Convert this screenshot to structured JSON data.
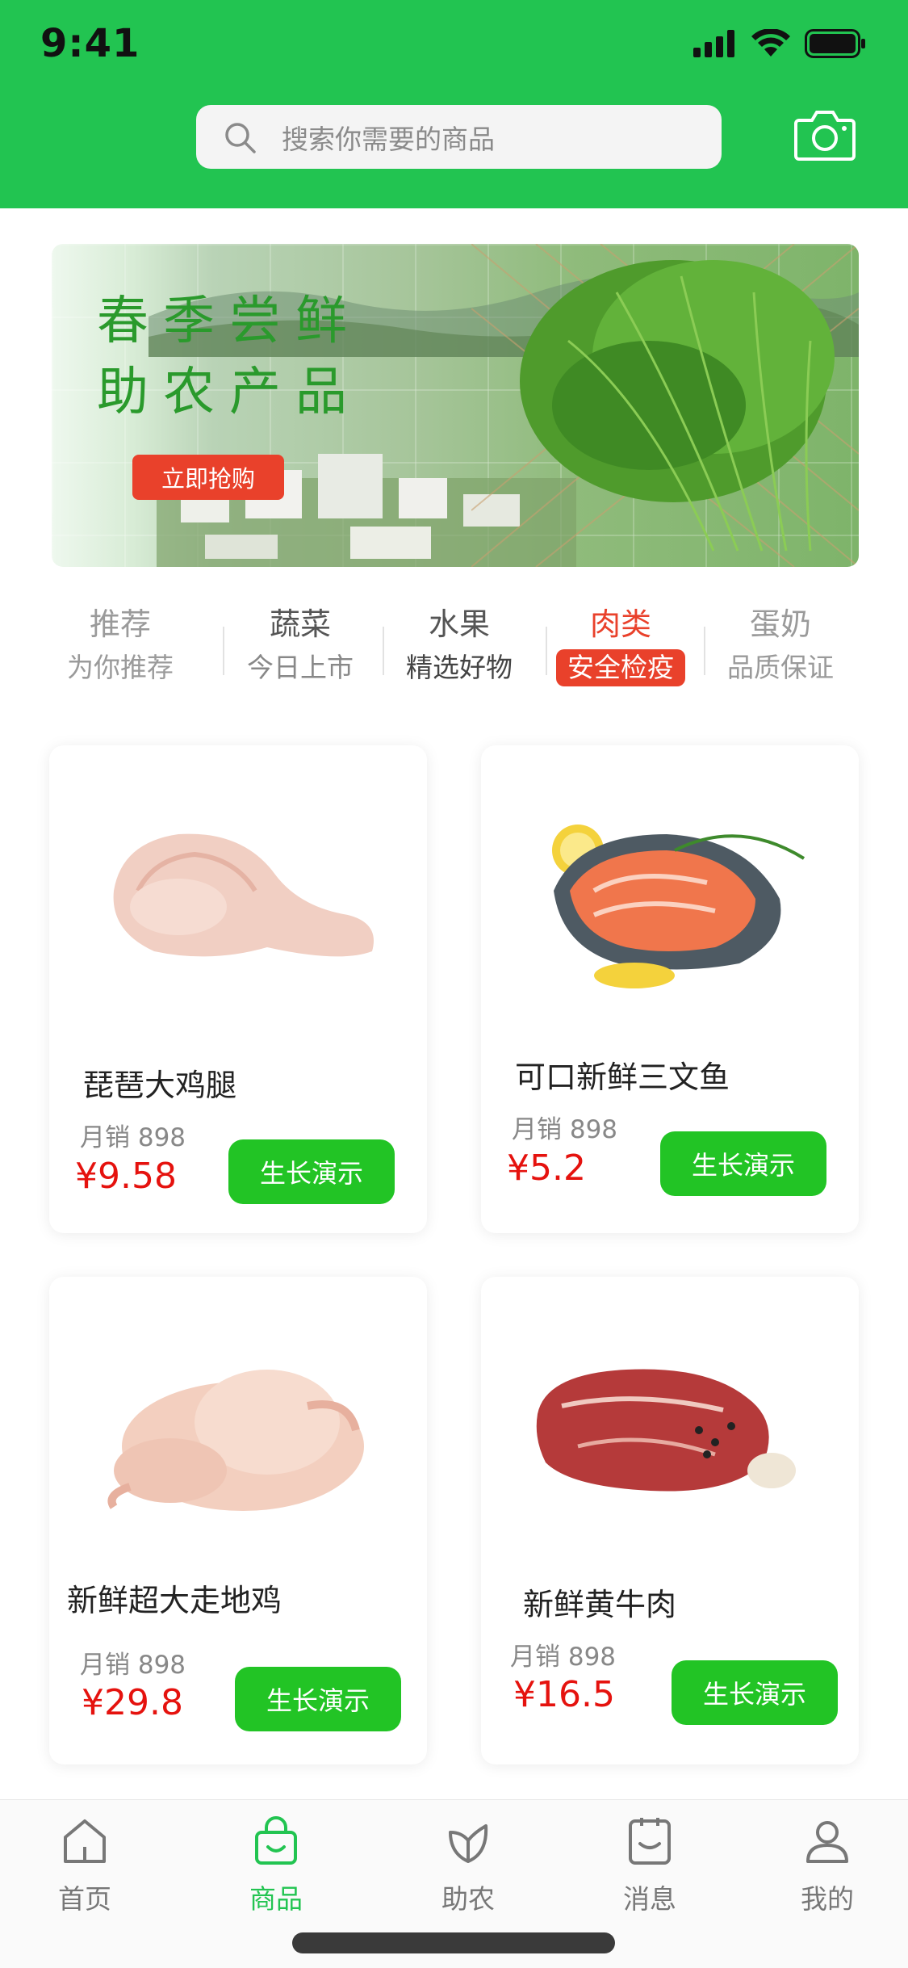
{
  "status_bar": {
    "time": "9:41"
  },
  "search": {
    "placeholder": "搜索你需要的商品"
  },
  "banner": {
    "line1": "春季尝鲜",
    "line2": "助农产品",
    "button": "立即抢购"
  },
  "categories": [
    {
      "title": "推荐",
      "subtitle": "为你推荐"
    },
    {
      "title": "蔬菜",
      "subtitle": "今日上市"
    },
    {
      "title": "水果",
      "subtitle": "精选好物"
    },
    {
      "title": "肉类",
      "subtitle": "安全检疫"
    },
    {
      "title": "蛋奶",
      "subtitle": "品质保证"
    }
  ],
  "products": [
    {
      "name": "琵琶大鸡腿",
      "sales": "月销 898",
      "price": "¥9.58",
      "button": "生长演示"
    },
    {
      "name": "可口新鲜三文鱼",
      "sales": "月销 898",
      "price": "¥5.2",
      "button": "生长演示"
    },
    {
      "name": "新鲜超大走地鸡",
      "sales": "月销  898",
      "price": "¥29.8",
      "button": "生长演示"
    },
    {
      "name": "新鲜黄牛肉",
      "sales": "月销  898",
      "price": "¥16.5",
      "button": "生长演示"
    }
  ],
  "tabs": [
    {
      "label": "首页",
      "icon": "home-icon"
    },
    {
      "label": "商品",
      "icon": "shopping-bag-icon"
    },
    {
      "label": "助农",
      "icon": "leaf-icon"
    },
    {
      "label": "消息",
      "icon": "message-icon"
    },
    {
      "label": "我的",
      "icon": "user-icon"
    }
  ],
  "colors": {
    "brand": "#22c451",
    "accent": "#e9412b",
    "price": "#e5120e",
    "button": "#22c425"
  }
}
